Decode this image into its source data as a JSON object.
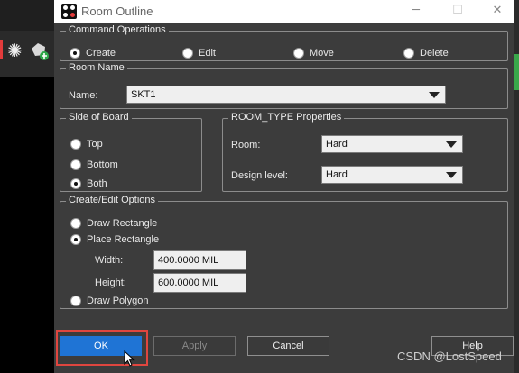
{
  "window": {
    "title": "Room Outline"
  },
  "command_operations": {
    "legend": "Command Operations",
    "options": [
      "Create",
      "Edit",
      "Move",
      "Delete"
    ],
    "selected": "Create"
  },
  "room_name": {
    "legend": "Room Name",
    "label": "Name:",
    "value": "SKT1"
  },
  "side_of_board": {
    "legend": "Side of Board",
    "options": [
      "Top",
      "Bottom",
      "Both"
    ],
    "selected": "Both"
  },
  "room_type": {
    "legend": "ROOM_TYPE Properties",
    "room_label": "Room:",
    "room_value": "Hard",
    "design_level_label": "Design level:",
    "design_level_value": "Hard"
  },
  "create_edit": {
    "legend": "Create/Edit Options",
    "draw_rectangle": "Draw Rectangle",
    "place_rectangle": "Place Rectangle",
    "width_label": "Width:",
    "width_value": "400.0000 MIL",
    "height_label": "Height:",
    "height_value": "600.0000 MIL",
    "draw_polygon": "Draw Polygon",
    "selected": "Place Rectangle"
  },
  "buttons": {
    "ok": "OK",
    "apply": "Apply",
    "cancel": "Cancel",
    "help": "Help"
  },
  "watermark": "CSDN @LostSpeed",
  "colors": {
    "primary": "#1f74d5",
    "highlight": "#e0463f",
    "dialog_bg": "#3c3c3c"
  }
}
